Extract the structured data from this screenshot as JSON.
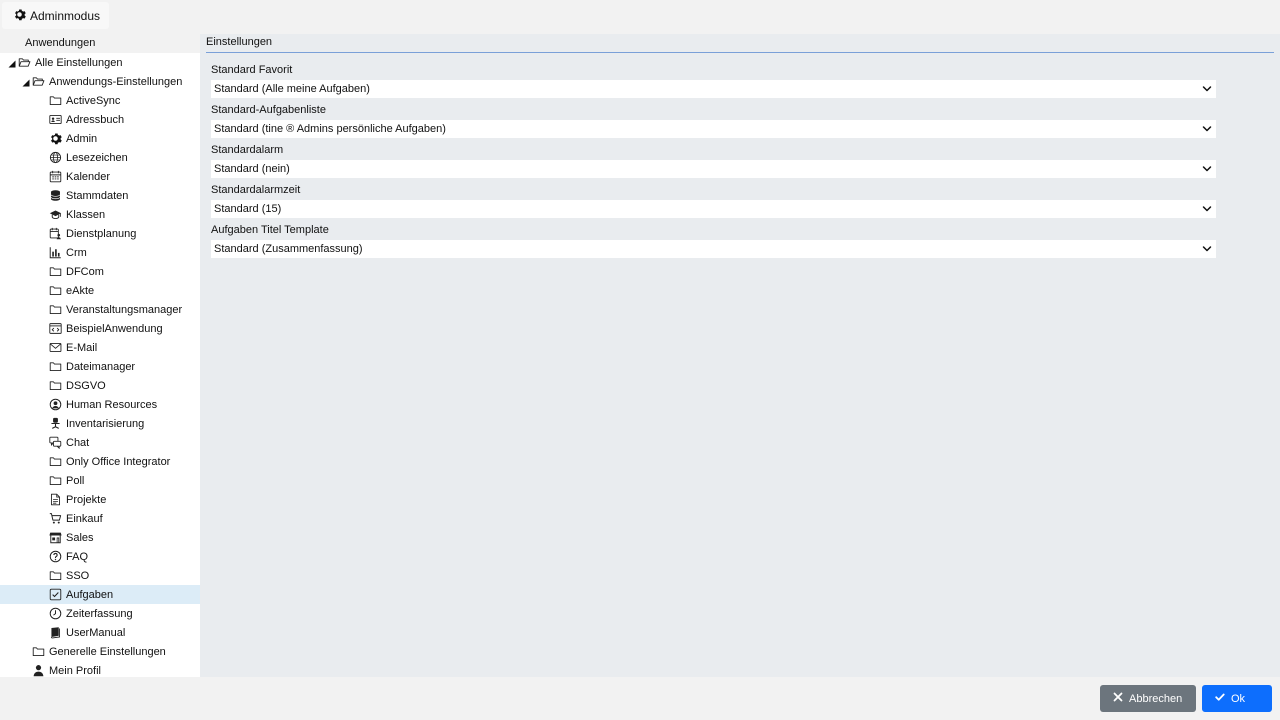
{
  "admin_mode": {
    "label": "Adminmodus",
    "icon": "gear-icon"
  },
  "sidebar": {
    "title": "Anwendungen",
    "tree": [
      {
        "label": "Alle Einstellungen",
        "icon": "folder-open-icon",
        "level": 0,
        "expanded": true
      },
      {
        "label": "Anwendungs-Einstellungen",
        "icon": "folder-open-icon",
        "level": 1,
        "expanded": true
      },
      {
        "label": "ActiveSync",
        "icon": "folder-icon",
        "level": 2
      },
      {
        "label": "Adressbuch",
        "icon": "address-card-icon",
        "level": 2
      },
      {
        "label": "Admin",
        "icon": "gear-icon",
        "level": 2
      },
      {
        "label": "Lesezeichen",
        "icon": "globe-icon",
        "level": 2
      },
      {
        "label": "Kalender",
        "icon": "calendar-icon",
        "level": 2
      },
      {
        "label": "Stammdaten",
        "icon": "database-icon",
        "level": 2
      },
      {
        "label": "Klassen",
        "icon": "graduation-cap-icon",
        "level": 2
      },
      {
        "label": "Dienstplanung",
        "icon": "calendar-user-icon",
        "level": 2
      },
      {
        "label": "Crm",
        "icon": "chart-bar-icon",
        "level": 2
      },
      {
        "label": "DFCom",
        "icon": "folder-icon",
        "level": 2
      },
      {
        "label": "eAkte",
        "icon": "folder-icon",
        "level": 2
      },
      {
        "label": "Veranstaltungsmanager",
        "icon": "folder-icon",
        "level": 2
      },
      {
        "label": "BeispielAnwendung",
        "icon": "code-window-icon",
        "level": 2
      },
      {
        "label": "E-Mail",
        "icon": "envelope-icon",
        "level": 2
      },
      {
        "label": "Dateimanager",
        "icon": "folder-icon",
        "level": 2
      },
      {
        "label": "DSGVO",
        "icon": "folder-icon",
        "level": 2
      },
      {
        "label": "Human Resources",
        "icon": "user-circle-icon",
        "level": 2
      },
      {
        "label": "Inventarisierung",
        "icon": "office-chair-icon",
        "level": 2
      },
      {
        "label": "Chat",
        "icon": "chat-icon",
        "level": 2
      },
      {
        "label": "Only Office Integrator",
        "icon": "folder-icon",
        "level": 2
      },
      {
        "label": "Poll",
        "icon": "folder-icon",
        "level": 2
      },
      {
        "label": "Projekte",
        "icon": "file-text-icon",
        "level": 2
      },
      {
        "label": "Einkauf",
        "icon": "shopping-cart-icon",
        "level": 2
      },
      {
        "label": "Sales",
        "icon": "store-icon",
        "level": 2
      },
      {
        "label": "FAQ",
        "icon": "question-circle-icon",
        "level": 2
      },
      {
        "label": "SSO",
        "icon": "folder-icon",
        "level": 2
      },
      {
        "label": "Aufgaben",
        "icon": "checkbox-icon",
        "level": 2,
        "selected": true
      },
      {
        "label": "Zeiterfassung",
        "icon": "clock-icon",
        "level": 2
      },
      {
        "label": "UserManual",
        "icon": "book-icon",
        "level": 2
      },
      {
        "label": "Generelle Einstellungen",
        "icon": "folder-icon",
        "level": 1
      },
      {
        "label": "Mein Profil",
        "icon": "user-icon",
        "level": 1
      }
    ]
  },
  "main": {
    "title": "Einstellungen",
    "fields": [
      {
        "label": "Standard Favorit",
        "value": "Standard (Alle meine Aufgaben)"
      },
      {
        "label": "Standard-Aufgabenliste",
        "value": "Standard (tine ® Admins persönliche Aufgaben)"
      },
      {
        "label": "Standardalarm",
        "value": "Standard (nein)"
      },
      {
        "label": "Standardalarmzeit",
        "value": "Standard (15)"
      },
      {
        "label": "Aufgaben Titel Template",
        "value": "Standard (Zusammenfassung)"
      }
    ]
  },
  "footer": {
    "cancel_label": "Abbrechen",
    "ok_label": "Ok"
  },
  "colors": {
    "selected_row": "#dcecf7",
    "cancel_button": "#6c757d",
    "ok_button": "#0d6efd",
    "header_rule": "#7aa0d8"
  }
}
